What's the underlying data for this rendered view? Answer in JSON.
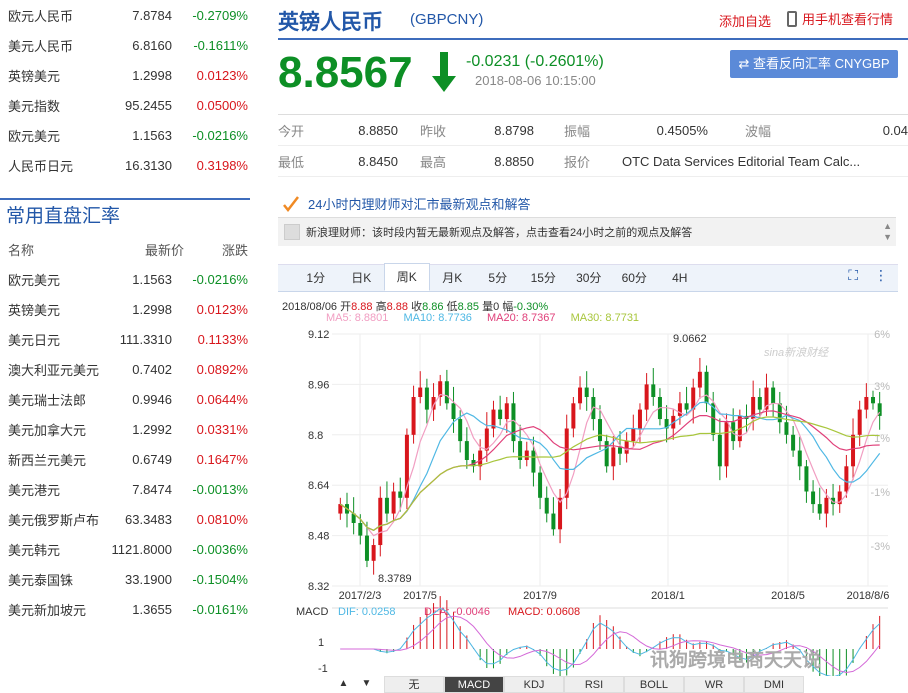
{
  "left_top_rates": [
    {
      "name": "欧元人民币",
      "price": "7.8784",
      "change": "-0.2709%",
      "dir": "down"
    },
    {
      "name": "美元人民币",
      "price": "6.8160",
      "change": "-0.1611%",
      "dir": "down"
    },
    {
      "name": "英镑美元",
      "price": "1.2998",
      "change": "0.0123%",
      "dir": "up"
    },
    {
      "name": "美元指数",
      "price": "95.2455",
      "change": "0.0500%",
      "dir": "up"
    },
    {
      "name": "欧元美元",
      "price": "1.1563",
      "change": "-0.0216%",
      "dir": "down"
    },
    {
      "name": "人民币日元",
      "price": "16.3130",
      "change": "0.3198%",
      "dir": "up"
    }
  ],
  "direct": {
    "title": "常用直盘汇率",
    "headers": {
      "name": "名称",
      "price": "最新价",
      "change": "涨跌"
    },
    "rows": [
      {
        "name": "欧元美元",
        "price": "1.1563",
        "change": "-0.0216%",
        "dir": "down"
      },
      {
        "name": "英镑美元",
        "price": "1.2998",
        "change": "0.0123%",
        "dir": "up"
      },
      {
        "name": "美元日元",
        "price": "111.3310",
        "change": "0.1133%",
        "dir": "up"
      },
      {
        "name": "澳大利亚元美元",
        "price": "0.7402",
        "change": "0.0892%",
        "dir": "up"
      },
      {
        "name": "美元瑞士法郎",
        "price": "0.9946",
        "change": "0.0644%",
        "dir": "up"
      },
      {
        "name": "美元加拿大元",
        "price": "1.2992",
        "change": "0.0331%",
        "dir": "up"
      },
      {
        "name": "新西兰元美元",
        "price": "0.6749",
        "change": "0.1647%",
        "dir": "up"
      },
      {
        "name": "美元港元",
        "price": "7.8474",
        "change": "-0.0013%",
        "dir": "down"
      },
      {
        "name": "美元俄罗斯卢布",
        "price": "63.3483",
        "change": "0.0810%",
        "dir": "up"
      },
      {
        "name": "美元韩元",
        "price": "1121.8000",
        "change": "-0.0036%",
        "dir": "down"
      },
      {
        "name": "美元泰国铢",
        "price": "33.1900",
        "change": "-0.1504%",
        "dir": "down"
      },
      {
        "name": "美元新加坡元",
        "price": "1.3655",
        "change": "-0.0161%",
        "dir": "down"
      }
    ]
  },
  "header": {
    "title": "英镑人民币",
    "code": "(GBPCNY)",
    "add": "添加自选",
    "phone": "用手机查看行情"
  },
  "quote": {
    "price": "8.8567",
    "change": "-0.0231 (-0.2601%)",
    "time": "2018-08-06 10:15:00",
    "reverse": "⇄ 查看反向汇率 CNYGBP"
  },
  "stats": {
    "row1": [
      {
        "l": "今开",
        "v": "8.8850"
      },
      {
        "l": "昨收",
        "v": "8.8798"
      },
      {
        "l": "振幅",
        "v": "0.4505%"
      },
      {
        "l": "波幅",
        "v": "0.04"
      }
    ],
    "row2": [
      {
        "l": "最低",
        "v": "8.8450"
      },
      {
        "l": "最高",
        "v": "8.8850"
      },
      {
        "l": "报价",
        "v": "OTC Data Services Editorial Team Calc..."
      }
    ]
  },
  "tip": "24小时内理财师对汇市最新观点和解答",
  "news": "新浪理财师：该时段内暂无最新观点及解答，点击查看24小时之前的观点及解答",
  "tabs": [
    "1分",
    "日K",
    "周K",
    "月K",
    "5分",
    "15分",
    "30分",
    "60分",
    "4H"
  ],
  "active_tab": "周K",
  "ohlc": {
    "date": "2018/08/06",
    "o_l": "开",
    "o": "8.88",
    "h_l": "高",
    "h": "8.88",
    "c_l": "收",
    "c": "8.86",
    "lo_l": "低",
    "lo": "8.85",
    "v_l": "量",
    "v": "0",
    "a_l": "幅",
    "a": "-0.30%"
  },
  "ma": {
    "ma5": "MA5: 8.8801",
    "ma10": "MA10: 8.7736",
    "ma20": "MA20: 8.7367",
    "ma30": "MA30: 8.7731"
  },
  "colors": {
    "up": "#d8161c",
    "down": "#0d8f25",
    "ma5": "#f19ec2",
    "ma10": "#4fb8e4",
    "ma20": "#e0407a",
    "ma30": "#a8c63c"
  },
  "chart_data": {
    "type": "candlestick",
    "y_ticks": [
      "9.12",
      "8.96",
      "8.8",
      "8.64",
      "8.48",
      "8.32"
    ],
    "ylim": [
      8.32,
      9.12
    ],
    "pct_ticks": [
      "6%",
      "3%",
      "1%",
      "-1%",
      "-3%"
    ],
    "x_ticks": [
      "2017/2/3",
      "2017/5",
      "2017/9",
      "2018/1",
      "2018/5",
      "2018/8/6"
    ],
    "annotations": [
      "9.0662",
      "8.3789"
    ],
    "logo": "sina新浪财经",
    "close": [
      8.58,
      8.55,
      8.52,
      8.48,
      8.4,
      8.45,
      8.6,
      8.55,
      8.62,
      8.6,
      8.8,
      8.92,
      8.95,
      8.88,
      8.92,
      8.97,
      8.9,
      8.85,
      8.78,
      8.72,
      8.7,
      8.75,
      8.82,
      8.88,
      8.85,
      8.9,
      8.78,
      8.72,
      8.75,
      8.68,
      8.6,
      8.55,
      8.5,
      8.6,
      8.82,
      8.9,
      8.95,
      8.92,
      8.85,
      8.78,
      8.7,
      8.76,
      8.74,
      8.78,
      8.82,
      8.88,
      8.96,
      8.92,
      8.85,
      8.82,
      8.86,
      8.9,
      8.88,
      8.95,
      9.0,
      8.9,
      8.8,
      8.7,
      8.84,
      8.78,
      8.86,
      8.85,
      8.92,
      8.88,
      8.95,
      8.9,
      8.84,
      8.8,
      8.75,
      8.7,
      8.62,
      8.58,
      8.55,
      8.6,
      8.58,
      8.62,
      8.7,
      8.8,
      8.88,
      8.92,
      8.9,
      8.86
    ],
    "macd": {
      "dif": "DIF: 0.0258",
      "dea": "DEA: -0.0046",
      "macd": "MACD: 0.0608",
      "label": "MACD",
      "y_ticks": [
        "1",
        "-1"
      ]
    }
  },
  "bottom_tabs": [
    "无",
    "MACD",
    "KDJ",
    "RSI",
    "BOLL",
    "WR",
    "DMI"
  ],
  "active_bottom": "MACD",
  "watermark": "讯狗跨境电商天天说"
}
